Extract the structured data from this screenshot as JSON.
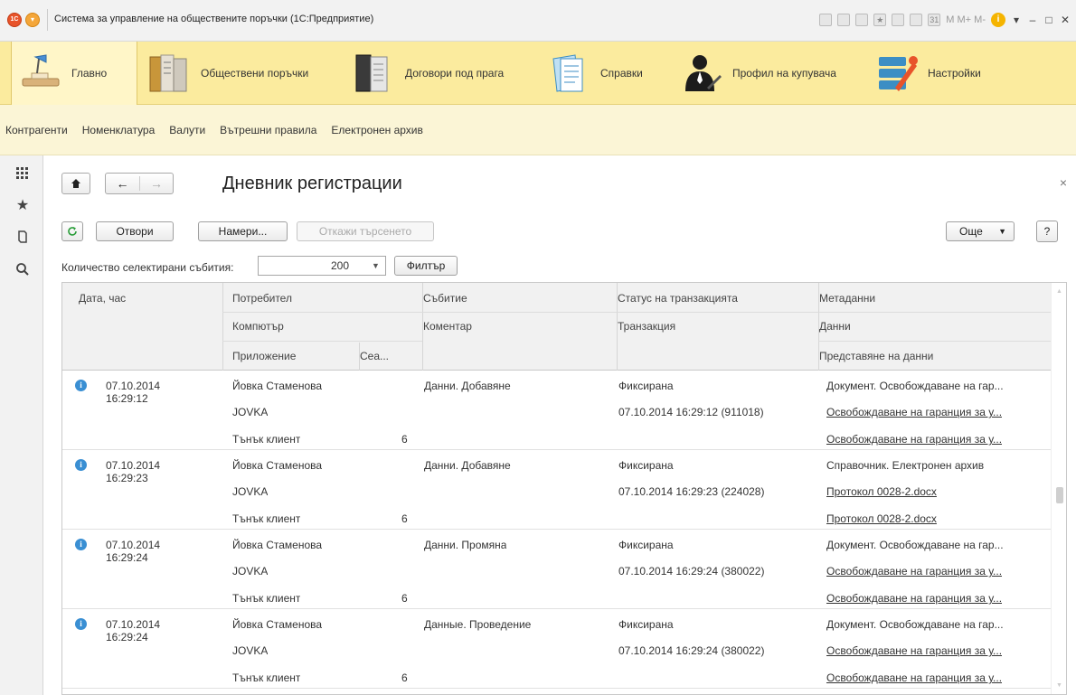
{
  "titlebar": {
    "title": "Система за управление на обществените поръчки  (1С:Предприятие)",
    "logo_text": "1С",
    "tools_text": "M  M+  M-"
  },
  "sections": [
    {
      "label": "Главно",
      "icon": "desk-lamp-icon"
    },
    {
      "label": "Обществени поръчки",
      "icon": "archive-folders-icon"
    },
    {
      "label": "Договори под прага",
      "icon": "binder-icon"
    },
    {
      "label": "Справки",
      "icon": "documents-icon"
    },
    {
      "label": "Профил на купувача",
      "icon": "user-profile-icon"
    },
    {
      "label": "Настройки",
      "icon": "settings-tools-icon"
    }
  ],
  "subnav": [
    "Контрагенти",
    "Номенклатура",
    "Валути",
    "Вътрешни правила",
    "Електронен архив"
  ],
  "leftpanel_icons": [
    "apps-grid-icon",
    "star-icon",
    "history-icon",
    "search-icon"
  ],
  "page": {
    "title": "Дневник регистрации",
    "home_icon": "home-icon",
    "back_icon": "arrow-left-icon",
    "forward_icon": "arrow-right-icon"
  },
  "toolbar": {
    "open_label": "Отвори",
    "find_label": "Намери...",
    "cancel_search_label": "Откажи търсенето",
    "more_label": "Още",
    "help_label": "?",
    "refresh_icon": "refresh-icon"
  },
  "filter": {
    "qty_label": "Количество селектирани събития:",
    "qty_value": "200",
    "filter_label": "Филтър"
  },
  "table": {
    "headers": {
      "date": "Дата, час",
      "user": "Потребител",
      "computer": "Компютър",
      "application": "Приложение",
      "session": "Сеа...",
      "event": "Събитие",
      "comment": "Коментар",
      "transaction_status": "Статус на транзакцията",
      "transaction": "Транзакция",
      "metadata": "Метаданни",
      "data": "Данни",
      "data_presentation": "Представяне на данни"
    },
    "rows": [
      {
        "date": "07.10.2014",
        "time": "16:29:12",
        "user": "Йовка Стаменова",
        "computer": "JOVKA",
        "application": "Тънък клиент",
        "session": "6",
        "event": "Данни. Добавяне",
        "comment": "",
        "status": "Фиксирана",
        "transaction": "07.10.2014 16:29:12 (911018)",
        "metadata": "Документ. Освобождаване на гар...",
        "data": "Освобождаване на гаранция за у...",
        "presentation": "Освобождаване на гаранция за у..."
      },
      {
        "date": "07.10.2014",
        "time": "16:29:23",
        "user": "Йовка Стаменова",
        "computer": "JOVKA",
        "application": "Тънък клиент",
        "session": "6",
        "event": "Данни. Добавяне",
        "comment": "",
        "status": "Фиксирана",
        "transaction": "07.10.2014 16:29:23 (224028)",
        "metadata": "Справочник. Електронен архив",
        "data": "Протокол 0028-2.docx",
        "presentation": "Протокол 0028-2.docx"
      },
      {
        "date": "07.10.2014",
        "time": "16:29:24",
        "user": "Йовка Стаменова",
        "computer": "JOVKA",
        "application": "Тънък клиент",
        "session": "6",
        "event": "Данни. Промяна",
        "comment": "",
        "status": "Фиксирана",
        "transaction": "07.10.2014 16:29:24 (380022)",
        "metadata": "Документ. Освобождаване на гар...",
        "data": "Освобождаване на гаранция за у...",
        "presentation": "Освобождаване на гаранция за у..."
      },
      {
        "date": "07.10.2014",
        "time": "16:29:24",
        "user": "Йовка Стаменова",
        "computer": "JOVKA",
        "application": "Тънък клиент",
        "session": "6",
        "event": "Данные. Проведение",
        "comment": "",
        "status": "Фиксирана",
        "transaction": "07.10.2014 16:29:24 (380022)",
        "metadata": "Документ. Освобождаване на гар...",
        "data": "Освобождаване на гаранция за у...",
        "presentation": "Освобождаване на гаранция за у..."
      }
    ]
  },
  "colors": {
    "sections_bg": "#fbeb9e",
    "subnav_bg": "#fbf5d6",
    "info_icon": "#3a8fd3",
    "refresh_icon": "#2a9d3a"
  }
}
